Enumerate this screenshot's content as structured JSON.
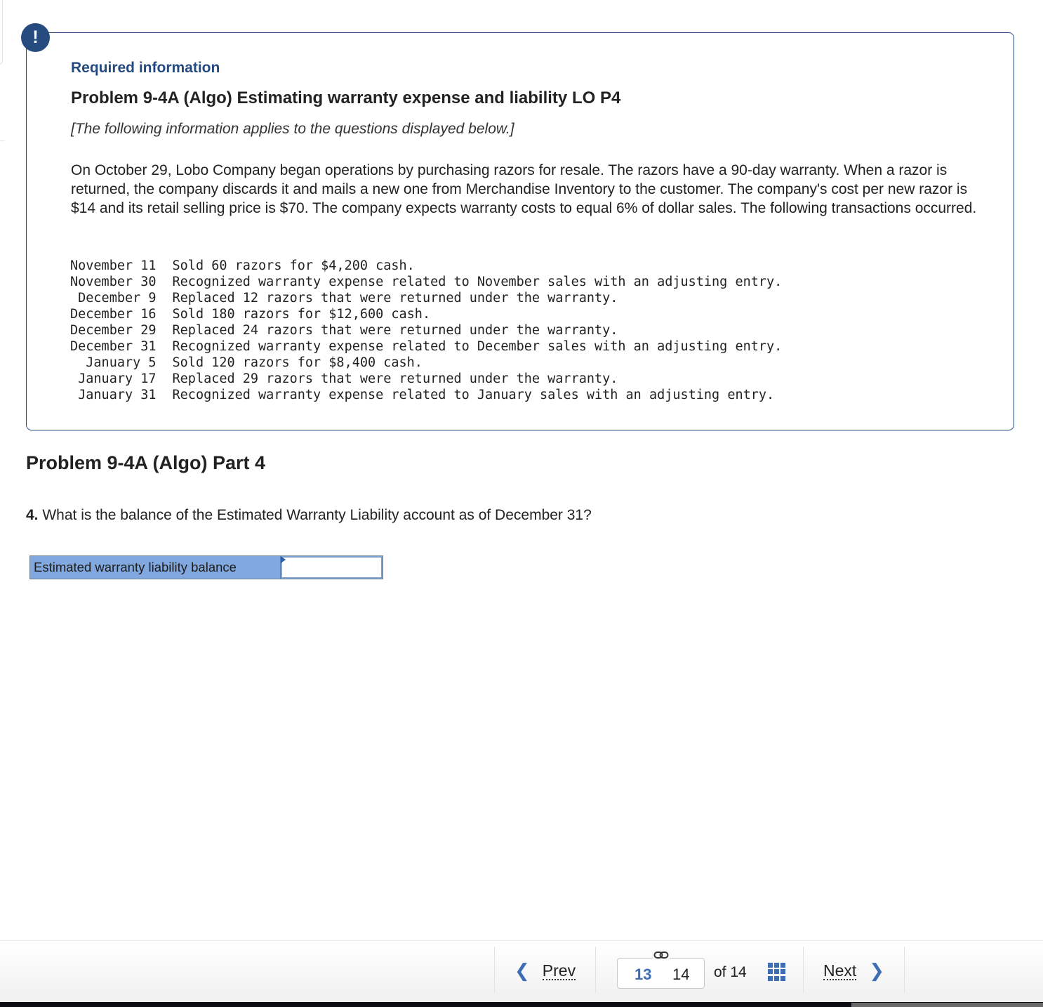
{
  "info": {
    "alert_symbol": "!",
    "required_label": "Required information",
    "problem_title": "Problem 9-4A (Algo) Estimating warranty expense and liability LO P4",
    "applies_note": "[The following information applies to the questions displayed below.]",
    "intro": "On October 29, Lobo Company began operations by purchasing razors for resale. The razors have a 90-day warranty. When a razor is returned, the company discards it and mails a new one from Merchandise Inventory to the customer. The company's cost per new razor is $14 and its retail selling price is $70. The company expects warranty costs to equal 6%  of dollar sales. The following transactions occurred.",
    "transactions": [
      {
        "date": "November 11",
        "description": "Sold 60 razors for $4,200 cash."
      },
      {
        "date": "November 30",
        "description": "Recognized warranty expense related to November sales with an adjusting entry."
      },
      {
        "date": "December 9",
        "description": "Replaced 12 razors that were returned under the warranty."
      },
      {
        "date": "December 16",
        "description": "Sold 180 razors for $12,600 cash."
      },
      {
        "date": "December 29",
        "description": "Replaced 24 razors that were returned under the warranty."
      },
      {
        "date": "December 31",
        "description": "Recognized warranty expense related to December sales with an adjusting entry."
      },
      {
        "date": "January 5",
        "description": "Sold 120 razors for $8,400 cash."
      },
      {
        "date": "January 17",
        "description": "Replaced 29 razors that were returned under the warranty."
      },
      {
        "date": "January 31",
        "description": "Recognized warranty expense related to January sales with an adjusting entry."
      }
    ]
  },
  "part": {
    "title": "Problem 9-4A (Algo) Part 4",
    "question_number": "4.",
    "question_text": " What is the balance of the Estimated Warranty Liability account as of December 31?",
    "answer_label": "Estimated warranty liability balance",
    "answer_value": ""
  },
  "footer": {
    "prev_label": "Prev",
    "next_label": "Next",
    "current_page": "13",
    "next_page": "14",
    "of_label": "of 14",
    "colors": {
      "accent": "#3e6db4",
      "header_blue": "#244a80",
      "label_fill": "#81a8df"
    }
  }
}
